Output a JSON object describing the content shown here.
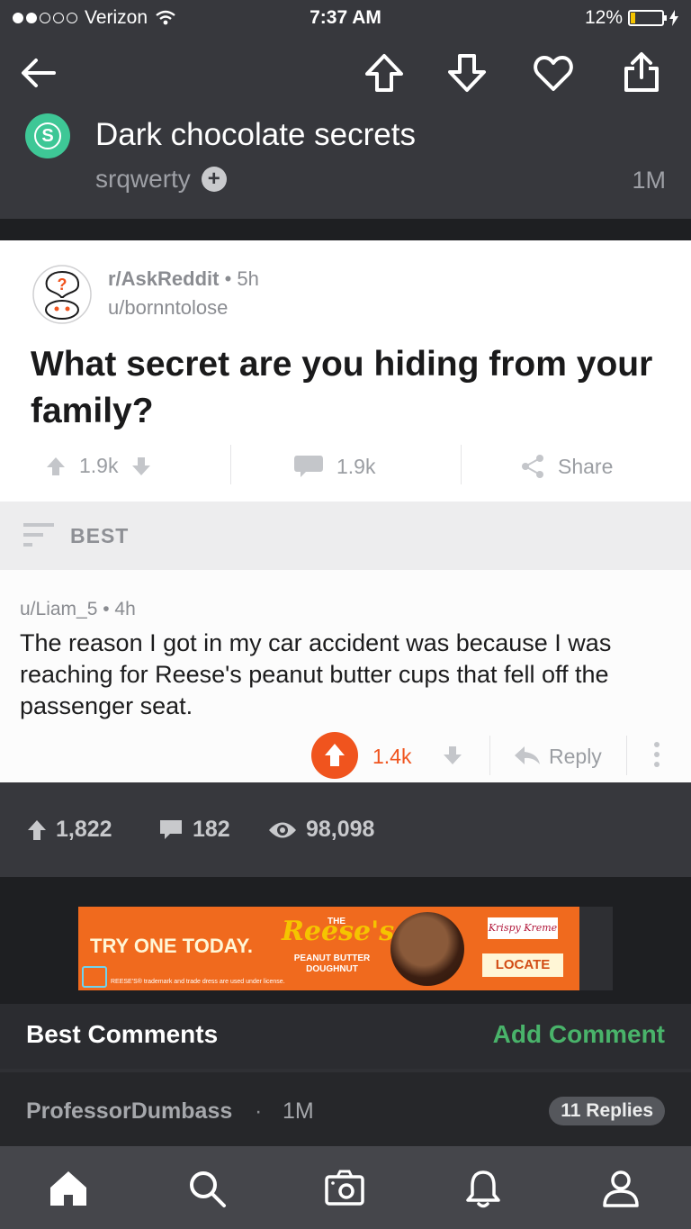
{
  "status_bar": {
    "carrier": "Verizon",
    "time": "7:37 AM",
    "battery": "12%"
  },
  "header": {
    "title": "Dark chocolate secrets",
    "avatar_letter": "S",
    "author": "srqwerty",
    "age": "1M",
    "icons": [
      "back-arrow-icon",
      "upvote-icon",
      "downvote-icon",
      "heart-icon",
      "share-icon"
    ]
  },
  "screenshot": {
    "subreddit": "r/AskReddit",
    "post_age": "5h",
    "op": "u/bornntolose",
    "question": "What secret are you hiding from your family?",
    "votes": "1.9k",
    "comments": "1.9k",
    "share": "Share",
    "sort": "BEST",
    "comment": {
      "meta": "u/Liam_5 • 4h",
      "text": "The reason I got in my car accident was because I was reaching for Reese's peanut butter cups that fell off the passenger seat.",
      "score": "1.4k",
      "reply": "Reply"
    }
  },
  "stats": {
    "upvotes": "1,822",
    "comments": "182",
    "views": "98,098"
  },
  "ad": {
    "tagline": "TRY ONE TODAY.",
    "the": "THE",
    "brand": "Reese's",
    "product": "PEANUT BUTTER DOUGHNUT",
    "partner": "Krispy Kreme",
    "cta": "LOCATE",
    "fine_print": "REESE'S® trademark and trade dress are used under license."
  },
  "comments_section": {
    "heading": "Best Comments",
    "add": "Add Comment",
    "first": {
      "user": "ProfessorDumbass",
      "sep": "·",
      "age": "1M",
      "replies": "11 Replies"
    }
  },
  "tabs": [
    "home-icon",
    "search-icon",
    "camera-icon",
    "bell-icon",
    "profile-icon"
  ]
}
